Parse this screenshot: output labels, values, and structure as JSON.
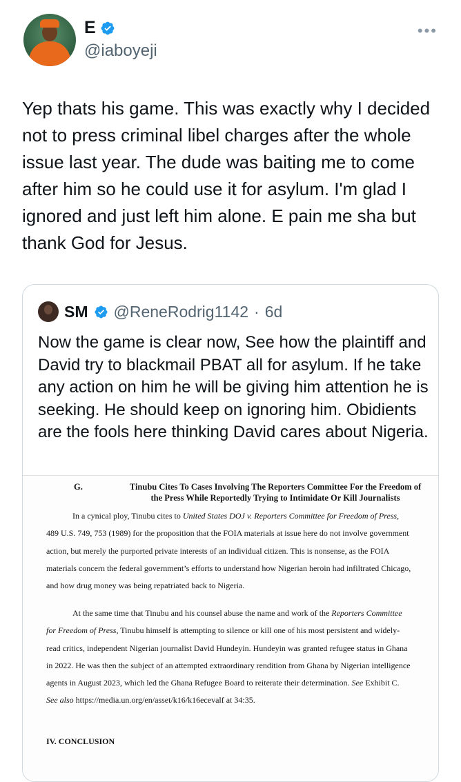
{
  "tweet": {
    "author_name": "E",
    "handle": "@iaboyeji",
    "more_icon": "more-horizontal-icon",
    "text": "Yep thats his game. This was exactly why I decided not to press criminal libel charges after the whole issue last year. The dude was baiting me to come after him so he could use it for asylum. I'm glad I ignored and just left him alone. E pain me sha but thank God for Jesus."
  },
  "quoted": {
    "author_name": "SM",
    "handle": "@ReneRodrig1142",
    "separator": "·",
    "time": "6d",
    "text": "Now the game is clear now, See how the plaintiff and David try to blackmail PBAT all for asylum. If he take any action on him he will be giving him attention he is seeking. He should keep on ignoring him. Obidients are the fools here thinking David cares about Nigeria."
  },
  "document": {
    "section_letter": "G.",
    "section_title": "Tinubu Cites To Cases Involving The Reporters Committee For the Freedom of the Press While Reportedly Trying to Intimidate Or Kill Journalists",
    "p1_a": "In a cynical ploy, Tinubu cites to ",
    "p1_case": "United States DOJ v. Reporters Committee for Freedom of Press,",
    "p1_b": " 489 U.S. 749, 753 (1989) for the proposition that the FOIA materials at issue here do not involve government action, but merely the purported private interests of an individual citizen.  This is nonsense, as the FOIA materials concern the federal government’s efforts to understand how Nigerian heroin had infiltrated Chicago, and how drug money was being repatriated back to Nigeria.",
    "p2_a": "At the same time that Tinubu and his counsel abuse the name and work of the ",
    "p2_org": "Reporters Committee for Freedom of Press",
    "p2_b": ", Tinubu himself is attempting to silence or kill one of his most persistent and widely-read critics, independent Nigerian journalist David Hundeyin.  Hundeyin was granted refugee status in Ghana in 2022.  He was then the subject of an attempted extraordinary rendition from Ghana by Nigerian intelligence agents in August 2023, which led the Ghana Refugee Board to reiterate their determination.  ",
    "p2_see": "See",
    "p2_exhibit": " Exhibit C.  ",
    "p2_seealso": "See also",
    "p2_url": "https://media.un.org/en/asset/k16/k16ecevalf at 34:35.",
    "cut_heading": "IV.      CONCLUSION"
  },
  "colors": {
    "verified": "#1d9bf0",
    "muted": "#536471",
    "border": "#cfd9de"
  }
}
